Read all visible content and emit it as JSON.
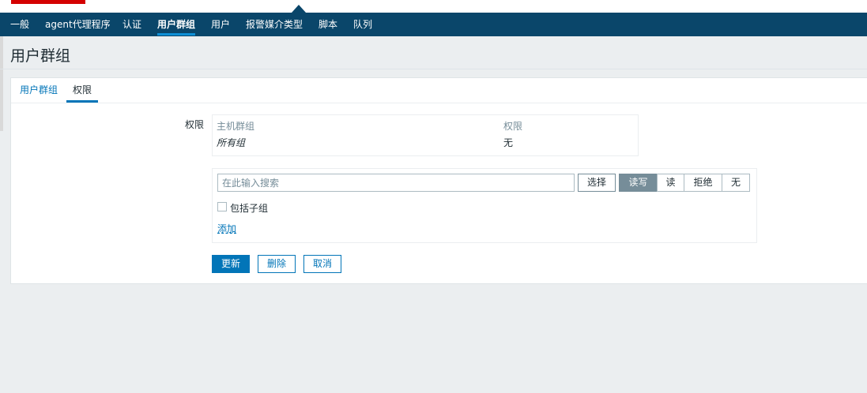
{
  "topnav": {
    "items": [
      "一般",
      "agent代理程序",
      "认证",
      "用户群组",
      "用户",
      "报警媒介类型",
      "脚本",
      "队列"
    ],
    "active_index": 3
  },
  "page": {
    "title": "用户群组"
  },
  "tabs": [
    {
      "label": "用户群组",
      "active": false
    },
    {
      "label": "权限",
      "active": true
    }
  ],
  "permissions": {
    "field_label": "权限",
    "headers": {
      "host_group": "主机群组",
      "permission": "权限"
    },
    "rows": [
      {
        "host_group": "所有组",
        "permission": "无"
      }
    ]
  },
  "assign": {
    "search_placeholder": "在此输入搜索",
    "select_label": "选择",
    "levels": [
      "读写",
      "读",
      "拒绝",
      "无"
    ],
    "selected_level": "读写",
    "include_subgroups_label": "包括子组",
    "include_subgroups_checked": false,
    "add_label": "添加"
  },
  "actions": {
    "update": "更新",
    "delete": "删除",
    "cancel": "取消"
  },
  "colors": {
    "nav_bg": "#0a466a",
    "accent": "#0275b8",
    "logo": "#d40000"
  }
}
